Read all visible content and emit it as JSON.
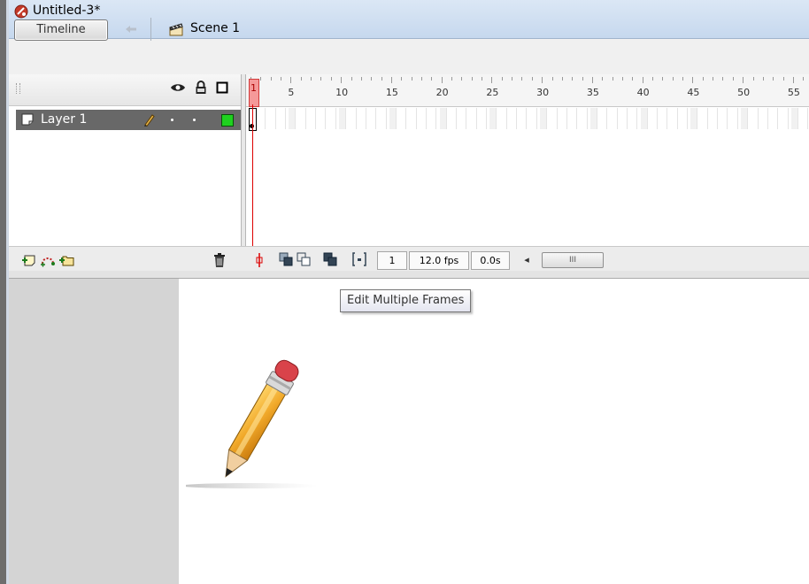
{
  "window": {
    "title": "Untitled-3*"
  },
  "toolbar": {
    "timeline_label": "Timeline",
    "scene_label": "Scene 1"
  },
  "icons": {
    "document": "flash-document-icon",
    "back": "back-arrow-icon",
    "scene": "scene-clapper-icon",
    "eye": "eye-icon",
    "lock": "lock-icon",
    "outline": "outline-square-icon",
    "layer": "layer-icon",
    "pencil": "pencil-icon",
    "new_layer": "new-layer-icon",
    "motion_guide": "motion-guide-icon",
    "new_folder": "new-folder-icon",
    "trash": "trash-icon",
    "center_frame": "center-frame-icon",
    "onion_skin": "onion-skin-icon",
    "onion_outlines": "onion-skin-outlines-icon",
    "edit_multiple": "edit-multiple-frames-icon",
    "modify_markers": "modify-onion-markers-icon"
  },
  "timeline": {
    "current_frame_label": "1",
    "ruler_labels": [
      "5",
      "10",
      "15",
      "20",
      "25",
      "30",
      "35",
      "40",
      "45",
      "50",
      "55"
    ],
    "layers": [
      {
        "name": "Layer 1",
        "color": "#1fd11f"
      }
    ],
    "status": {
      "frame": "1",
      "fps": "12.0 fps",
      "time": "0.0s"
    },
    "scroll_left": "◂",
    "scroll_thumb": "III"
  },
  "tooltip": {
    "text": "Edit Multiple Frames"
  },
  "colors": {
    "playhead": "#dd0000",
    "selected_layer_bg": "#686868",
    "pasteboard": "#d4d4d4",
    "stage": "#ffffff"
  }
}
